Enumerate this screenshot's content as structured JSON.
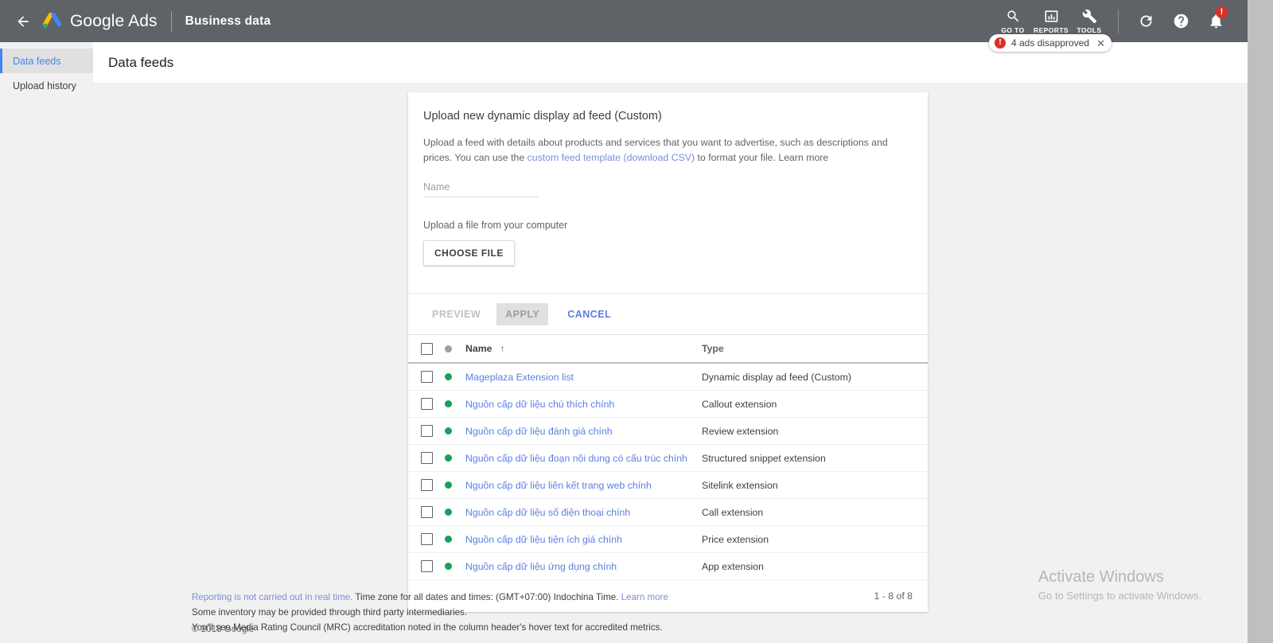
{
  "topbar": {
    "back_icon": "back-arrow-icon",
    "brand": "Google Ads",
    "section": "Business data",
    "tools": [
      {
        "icon": "search-icon",
        "label": "GO TO"
      },
      {
        "icon": "reports-bar-chart-icon",
        "label": "REPORTS"
      },
      {
        "icon": "wrench-tools-icon",
        "label": "TOOLS"
      }
    ],
    "refresh_icon": "refresh-icon",
    "help_icon": "help-question-icon",
    "bell_icon": "notifications-bell-icon",
    "bell_badge": "!"
  },
  "toast": {
    "icon": "error-alert-icon",
    "icon_glyph": "!",
    "text": "4 ads disapproved",
    "close": "✕"
  },
  "sidebar": {
    "items": [
      {
        "label": "Data feeds",
        "active": true
      },
      {
        "label": "Upload history",
        "active": false
      }
    ]
  },
  "page": {
    "title": "Data feeds"
  },
  "upload_card": {
    "title": "Upload new dynamic display ad feed (Custom)",
    "desc_part1": "Upload a feed with details about products and services that you want to advertise, such as descriptions and prices. You can use the ",
    "desc_link": "custom feed template (download CSV)",
    "desc_part2": " to format your file. ",
    "learn_more": "Learn more",
    "name_placeholder": "Name",
    "name_value": "",
    "upload_label": "Upload a file from your computer",
    "choose_file": "CHOOSE FILE",
    "actions": {
      "preview": "PREVIEW",
      "apply": "APPLY",
      "cancel": "CANCEL"
    }
  },
  "table": {
    "columns": {
      "name": "Name",
      "type": "Type",
      "sort_arrow": "↑"
    },
    "rows": [
      {
        "name": "Mageplaza Extension list",
        "type": "Dynamic display ad feed (Custom)",
        "status": "green"
      },
      {
        "name": "Nguồn cấp dữ liệu chú thích chính",
        "type": "Callout extension",
        "status": "green"
      },
      {
        "name": "Nguồn cấp dữ liệu đánh giá chính",
        "type": "Review extension",
        "status": "green"
      },
      {
        "name": "Nguồn cấp dữ liệu đoạn nội dung có cấu trúc chính",
        "type": "Structured snippet extension",
        "status": "green"
      },
      {
        "name": "Nguồn cấp dữ liệu liên kết trang web chính",
        "type": "Sitelink extension",
        "status": "green"
      },
      {
        "name": "Nguồn cấp dữ liệu số điện thoại chính",
        "type": "Call extension",
        "status": "green"
      },
      {
        "name": "Nguồn cấp dữ liệu tiện ích giá chính",
        "type": "Price extension",
        "status": "green"
      },
      {
        "name": "Nguồn cấp dữ liệu ứng dụng chính",
        "type": "App extension",
        "status": "green"
      }
    ],
    "pagination": "1 - 8 of 8"
  },
  "footer": {
    "line1_link": "Reporting is not carried out in real time.",
    "line1_rest": " Time zone for all dates and times: (GMT+07:00) Indochina Time. ",
    "line1_learn": "Learn more",
    "line2": "Some inventory may be provided through third party intermediaries.",
    "line3": "You'll see Media Rating Council (MRC) accreditation noted in the column header's hover text for accredited metrics.",
    "copyright": "© 2018 Google"
  },
  "watermark": {
    "line1": "Activate Windows",
    "line2": "Go to Settings to activate Windows."
  },
  "colors": {
    "topbar": "#5f6368",
    "accent_blue": "#4285f4",
    "link_blue": "#5b7fe0",
    "status_green": "#17a05a",
    "status_grey": "#9e9e9e",
    "alert_red": "#d93025"
  }
}
